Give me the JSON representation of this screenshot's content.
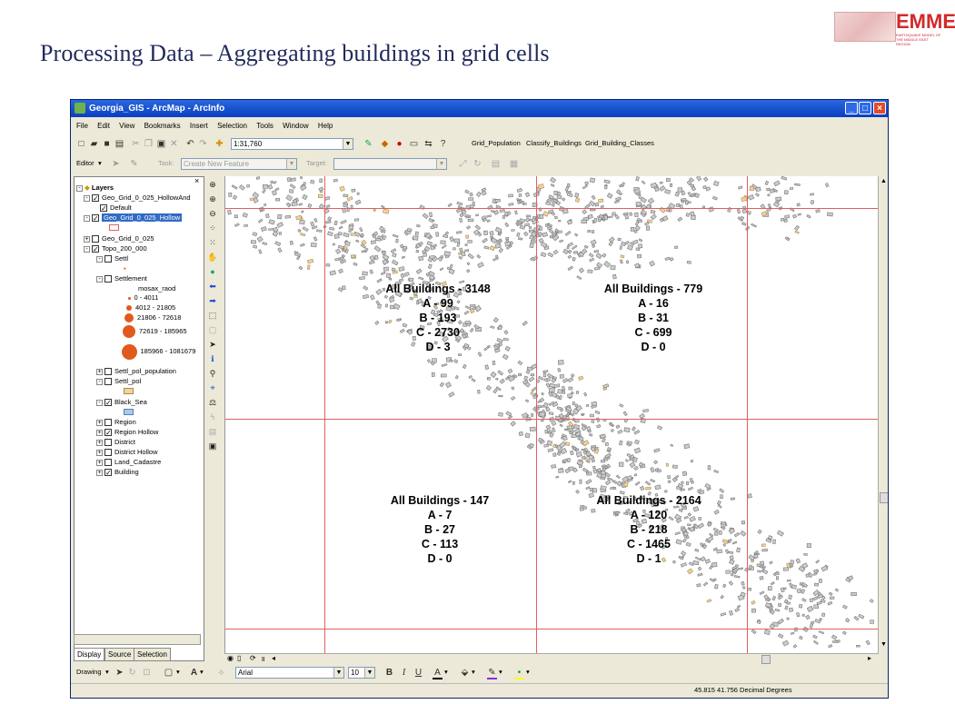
{
  "slide": {
    "title": "Processing Data – Aggregating buildings in grid cells"
  },
  "logo": {
    "brand": "EMME",
    "tagline": "EARTHQUAKE MODEL OF THE MIDDLE EAST REGION"
  },
  "window": {
    "title": "Georgia_GIS - ArcMap - ArcInfo",
    "buttons": [
      "_",
      "□",
      "×"
    ]
  },
  "menu": [
    "File",
    "Edit",
    "View",
    "Bookmarks",
    "Insert",
    "Selection",
    "Tools",
    "Window",
    "Help"
  ],
  "toolbar": {
    "scale": "1:31,760",
    "custom_tools": [
      "Grid_Population",
      "Classify_Buildings",
      "Grid_Building_Classes"
    ]
  },
  "editor": {
    "label": "Editor",
    "task_label": "Task:",
    "task_value": "Create New Feature",
    "target_label": "Target:"
  },
  "toc": {
    "root": "Layers",
    "layers": [
      {
        "label": "Geo_Grid_0_025_HollowAnd",
        "checked": true,
        "expand": "-"
      },
      {
        "label": "Default",
        "checked": true,
        "expand": ""
      },
      {
        "label": "Geo_Grid_0_025_Hollow",
        "checked": true,
        "expand": "-",
        "selected": true
      },
      {
        "label": "Geo_Grid_0_025",
        "checked": false,
        "expand": "+"
      },
      {
        "label": "Topo_200_000",
        "checked": true,
        "expand": "-"
      },
      {
        "label": "Settl",
        "checked": false,
        "expand": "-"
      },
      {
        "label": "Settlement",
        "checked": false,
        "expand": "-"
      },
      {
        "label": "Settl_pol_population",
        "checked": false,
        "expand": "+"
      },
      {
        "label": "Settl_pol",
        "checked": false,
        "expand": "-"
      },
      {
        "label": "Black_Sea",
        "checked": true,
        "expand": "-"
      },
      {
        "label": "Region",
        "checked": false,
        "expand": "+"
      },
      {
        "label": "Region Hollow",
        "checked": true,
        "expand": "+"
      },
      {
        "label": "District",
        "checked": false,
        "expand": "+"
      },
      {
        "label": "District Hollow",
        "checked": false,
        "expand": "+"
      },
      {
        "label": "Land_Cadastre",
        "checked": false,
        "expand": "+"
      },
      {
        "label": "Building",
        "checked": true,
        "expand": "+"
      }
    ],
    "legend_field": "mosax_raod",
    "legend": [
      {
        "label": "0 - 4011",
        "size": 3
      },
      {
        "label": "4012 - 21805",
        "size": 6
      },
      {
        "label": "21806 - 72618",
        "size": 10
      },
      {
        "label": "72619 - 185965",
        "size": 14
      },
      {
        "label": "185966 - 1081679",
        "size": 17
      }
    ],
    "tabs": [
      "Display",
      "Source",
      "Selection"
    ]
  },
  "map": {
    "cells": [
      {
        "title": "All Buildings - 3148",
        "a": "A - 99",
        "b": "B - 193",
        "c": "C - 2730",
        "d": "D - 3"
      },
      {
        "title": "All Buildings - 779",
        "a": "A - 16",
        "b": "B - 31",
        "c": "C - 699",
        "d": "D - 0"
      },
      {
        "title": "All Buildings - 147",
        "a": "A - 7",
        "b": "B - 27",
        "c": "C - 113",
        "d": "D - 0"
      },
      {
        "title": "All Buildings - 2164",
        "a": "A - 120",
        "b": "B - 218",
        "c": "C - 1465",
        "d": "D - 1"
      }
    ]
  },
  "drawing": {
    "label": "Drawing",
    "font": "Arial",
    "size": "10",
    "bold": "B",
    "italic": "I",
    "underline": "U"
  },
  "status": {
    "coords": "45.815  41.756 Decimal Degrees"
  },
  "colors": {
    "grid_line": "#e06060",
    "building": "#cbcbcb",
    "building_highlight": "#f2d39b",
    "title_color": "#1f2a5c"
  }
}
